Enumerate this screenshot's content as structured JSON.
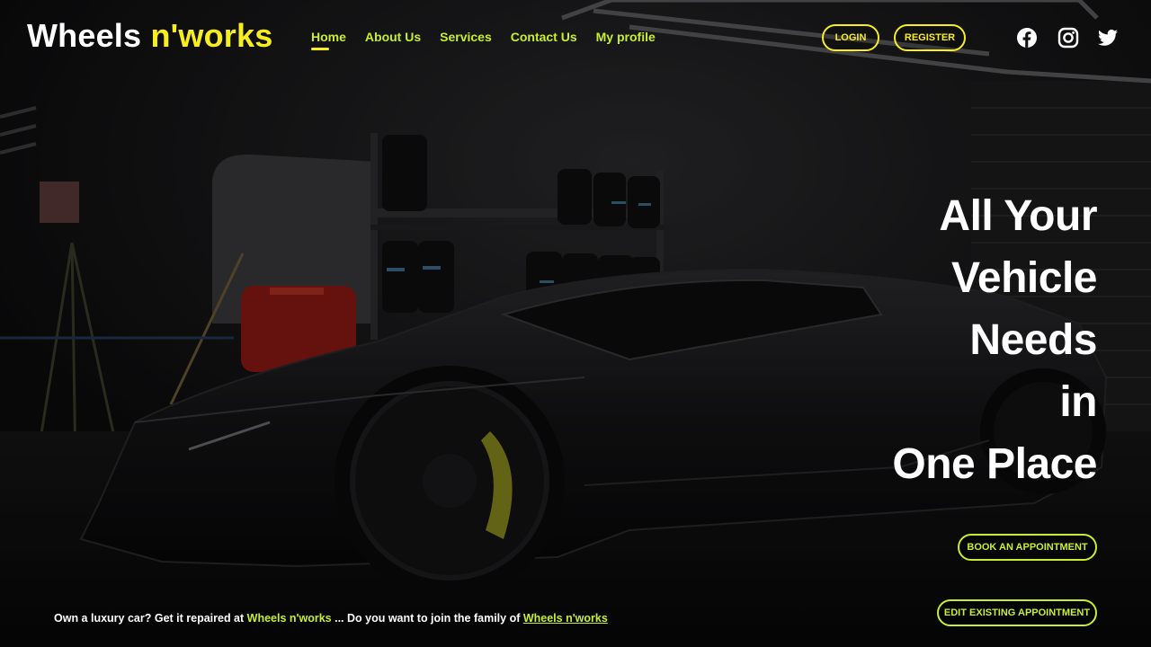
{
  "brand": {
    "name_part1": "Wheels",
    "name_part2": "n'works",
    "accent_color": "#f7ee22",
    "nav_color": "#c8ee2f"
  },
  "nav": {
    "items": [
      {
        "label": "Home",
        "active": true
      },
      {
        "label": "About Us",
        "active": false
      },
      {
        "label": "Services",
        "active": false
      },
      {
        "label": "Contact Us",
        "active": false
      },
      {
        "label": "My profile",
        "active": false
      }
    ]
  },
  "auth": {
    "login_label": "LOGIN",
    "register_label": "REGISTER"
  },
  "social": [
    "facebook-icon",
    "instagram-icon",
    "twitter-icon"
  ],
  "hero": {
    "lines": [
      "All Your",
      "Vehicle",
      "Needs",
      "in",
      "One Place"
    ]
  },
  "cta": {
    "book_label": "BOOK AN APPOINTMENT",
    "edit_label": "EDIT EXISTING APPOINTMENT"
  },
  "tagline": {
    "part1": "Own a luxury car? Get it repaired at ",
    "brand_inline": "Wheels n'works",
    "part2": " ... Do you want to join the family of ",
    "link_text": "Wheels n'works"
  }
}
